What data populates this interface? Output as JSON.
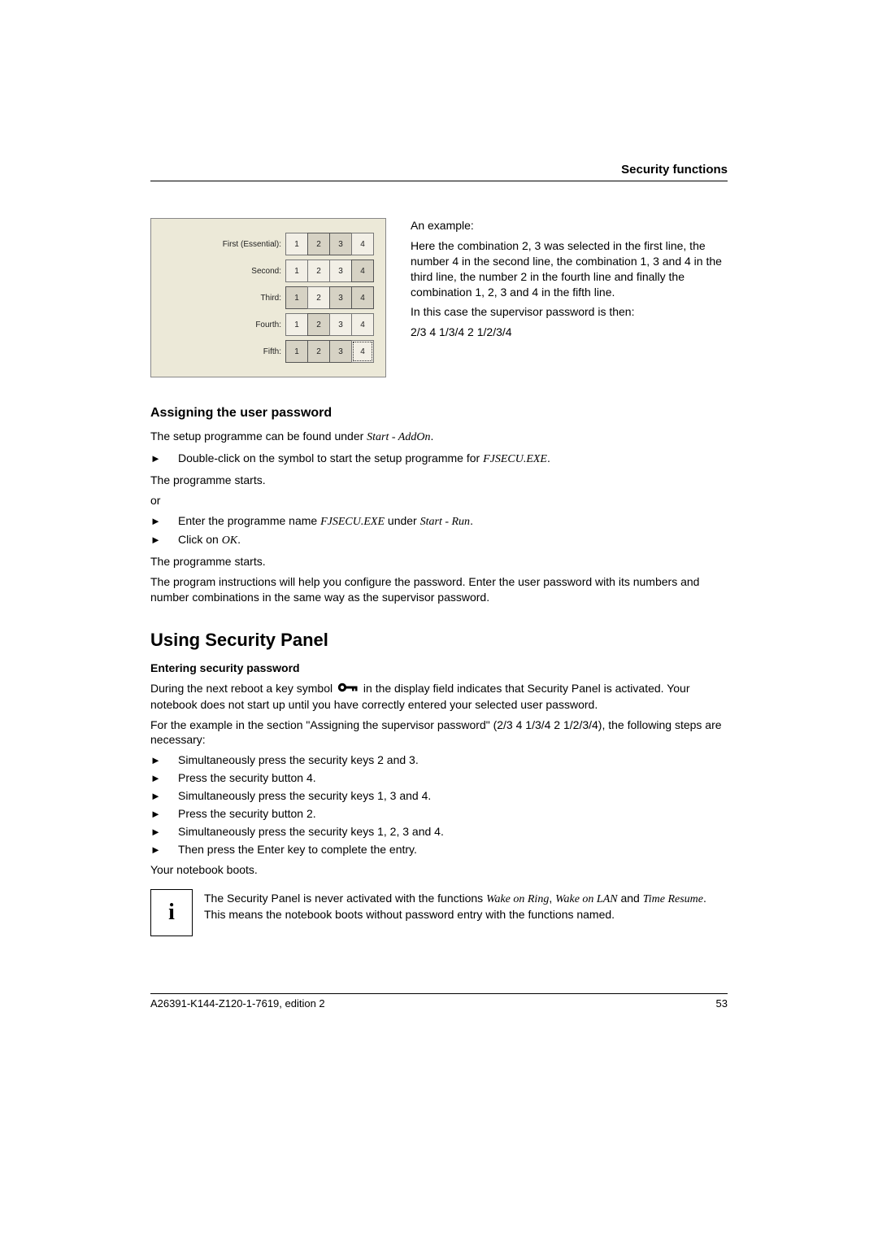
{
  "header": {
    "title": "Security functions"
  },
  "panel": {
    "rows": [
      {
        "label": "First (Essential):",
        "buttons": [
          "1",
          "2",
          "3",
          "4"
        ],
        "pressed": [
          1,
          2
        ],
        "dashed": []
      },
      {
        "label": "Second:",
        "buttons": [
          "1",
          "2",
          "3",
          "4"
        ],
        "pressed": [
          3
        ],
        "dashed": []
      },
      {
        "label": "Third:",
        "buttons": [
          "1",
          "2",
          "3",
          "4"
        ],
        "pressed": [
          0,
          2,
          3
        ],
        "dashed": []
      },
      {
        "label": "Fourth:",
        "buttons": [
          "1",
          "2",
          "3",
          "4"
        ],
        "pressed": [
          1
        ],
        "dashed": []
      },
      {
        "label": "Fifth:",
        "buttons": [
          "1",
          "2",
          "3",
          "4"
        ],
        "pressed": [
          0,
          1,
          2
        ],
        "dashed": [
          3
        ]
      }
    ]
  },
  "example": {
    "heading": "An example:",
    "p1": "Here the combination 2, 3 was selected in the first line, the number 4 in the second line, the combination 1, 3 and 4 in the third line, the number 2 in the fourth line and finally the combination 1, 2, 3 and 4 in the fifth line.",
    "p2": "In this case the supervisor password is then:",
    "p3": "2/3   4   1/3/4   2   1/2/3/4"
  },
  "assign": {
    "heading": "Assigning the user password",
    "p1a": "The setup programme can be found under ",
    "p1b": "Start - AddOn",
    "p1c": ".",
    "b1a": "Double-click on the symbol to start the setup programme for ",
    "b1b": "FJSECU.EXE",
    "b1c": ".",
    "p2": "The programme starts.",
    "or": "or",
    "b2a": "Enter the programme name ",
    "b2b": "FJSECU.EXE",
    "b2c": " under ",
    "b2d": "Start - Run",
    "b2e": ".",
    "b3a": "Click on ",
    "b3b": "OK",
    "b3c": ".",
    "p3": "The programme starts.",
    "p4": "The program instructions will help you configure the password. Enter the user password with its numbers and number combinations in the same way as the supervisor password."
  },
  "using": {
    "heading": "Using Security Panel",
    "sub": "Entering security password",
    "p1a": "During the next reboot a key symbol ",
    "p1b": " in the display field indicates that Security Panel is activated. Your notebook does not start up until you have correctly entered your selected user password.",
    "p2": "For the example in the section \"Assigning the supervisor password\" (2/3   4   1/3/4   2   1/2/3/4), the following steps are necessary:",
    "steps": [
      "Simultaneously press the security keys 2 and 3.",
      "Press the security button 4.",
      "Simultaneously press the security keys 1, 3 and 4.",
      "Press the security button 2.",
      "Simultaneously press the security keys 1, 2, 3 and 4.",
      "Then press the Enter key to complete the entry."
    ],
    "p3": "Your notebook boots.",
    "info_a": "The Security Panel is never activated with the functions ",
    "info_b": "Wake on Ring",
    "info_c": ", ",
    "info_d": "Wake on LAN",
    "info_e": " and ",
    "info_f": "Time Resume",
    "info_g": ". This means the notebook boots without password entry with the functions named."
  },
  "footer": {
    "left": "A26391-K144-Z120-1-7619, edition 2",
    "right": "53"
  },
  "icons": {
    "info": "i",
    "arrow": "►"
  }
}
